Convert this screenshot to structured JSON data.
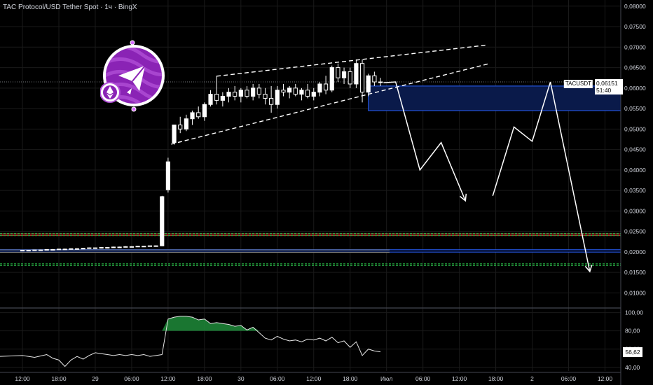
{
  "header": {
    "title": "TAC Protocol/USD Tether Spot · 1ч · BingX"
  },
  "price_label": {
    "symbol": "TACUSDT",
    "price": "0,06151",
    "countdown": "51:40"
  },
  "rsi_label": {
    "value": "56,62"
  },
  "colors": {
    "background": "#000000",
    "candle": "#ffffff",
    "demand_zone": "#0a1a4a",
    "support_blue": "#2962ff",
    "dashed_green": "#26a641",
    "resistance_red": "#c62828",
    "rsi_fill": "#1f8b3a"
  },
  "icons": {
    "logo": "tac-protocol-logo-icon",
    "arrows": "projection-arrow-icon"
  },
  "chart_data": {
    "type": "candlestick",
    "price_axis": {
      "ticks": [
        "0,08000",
        "0,07500",
        "0,07000",
        "0,06500",
        "0,06000",
        "0,05500",
        "0,05000",
        "0,04500",
        "0,04000",
        "0,03500",
        "0,03000",
        "0,02500",
        "0,02000",
        "0,01500",
        "0,01000"
      ],
      "ylim": [
        0.007,
        0.0815
      ]
    },
    "rsi_axis": {
      "ticks": [
        "100,00",
        "80,00",
        "60,00",
        "40,00"
      ],
      "ylim": [
        36,
        102
      ]
    },
    "time_axis": {
      "ticks": [
        {
          "label": "12:00",
          "slot": 0
        },
        {
          "label": "18:00",
          "slot": 6
        },
        {
          "label": "29",
          "slot": 12
        },
        {
          "label": "06:00",
          "slot": 18
        },
        {
          "label": "12:00",
          "slot": 24
        },
        {
          "label": "18:00",
          "slot": 30
        },
        {
          "label": "30",
          "slot": 36
        },
        {
          "label": "06:00",
          "slot": 42
        },
        {
          "label": "12:00",
          "slot": 48
        },
        {
          "label": "18:00",
          "slot": 54
        },
        {
          "label": "Июл",
          "slot": 60
        },
        {
          "label": "06:00",
          "slot": 66
        },
        {
          "label": "12:00",
          "slot": 72
        },
        {
          "label": "18:00",
          "slot": 78
        },
        {
          "label": "2",
          "slot": 84
        },
        {
          "label": "06:00",
          "slot": 90
        },
        {
          "label": "12:00",
          "slot": 96
        }
      ],
      "slot_range": [
        -3.7,
        98.6
      ]
    },
    "candles": [
      [
        0,
        0.0203,
        0.0204,
        0.0202,
        0.0204
      ],
      [
        1,
        0.0204,
        0.0205,
        0.0203,
        0.0204
      ],
      [
        2,
        0.0204,
        0.0205,
        0.0203,
        0.0205
      ],
      [
        3,
        0.0205,
        0.0206,
        0.0204,
        0.0205
      ],
      [
        4,
        0.0205,
        0.0206,
        0.0204,
        0.0206
      ],
      [
        5,
        0.0206,
        0.0207,
        0.0205,
        0.0206
      ],
      [
        6,
        0.0206,
        0.0207,
        0.0205,
        0.0207
      ],
      [
        7,
        0.0207,
        0.0208,
        0.0206,
        0.0207
      ],
      [
        8,
        0.0207,
        0.0208,
        0.0206,
        0.0208
      ],
      [
        9,
        0.0208,
        0.0209,
        0.0207,
        0.0208
      ],
      [
        10,
        0.0208,
        0.021,
        0.0207,
        0.0209
      ],
      [
        11,
        0.0209,
        0.0211,
        0.0208,
        0.021
      ],
      [
        12,
        0.021,
        0.0211,
        0.0209,
        0.021
      ],
      [
        13,
        0.021,
        0.0212,
        0.0209,
        0.0211
      ],
      [
        14,
        0.0211,
        0.0212,
        0.021,
        0.0211
      ],
      [
        15,
        0.0211,
        0.0213,
        0.021,
        0.0212
      ],
      [
        16,
        0.0212,
        0.0213,
        0.0211,
        0.0212
      ],
      [
        17,
        0.0212,
        0.0214,
        0.0211,
        0.0213
      ],
      [
        18,
        0.0213,
        0.0214,
        0.0212,
        0.0213
      ],
      [
        19,
        0.0213,
        0.0214,
        0.0212,
        0.0214
      ],
      [
        20,
        0.0214,
        0.0215,
        0.0213,
        0.0214
      ],
      [
        21,
        0.0214,
        0.0215,
        0.0213,
        0.0215
      ],
      [
        22,
        0.0215,
        0.0216,
        0.0214,
        0.0215
      ],
      [
        23,
        0.0215,
        0.0337,
        0.0214,
        0.0335
      ],
      [
        24,
        0.0352,
        0.043,
        0.0345,
        0.042
      ],
      [
        25,
        0.0467,
        0.051,
        0.0462,
        0.051
      ],
      [
        26,
        0.051,
        0.053,
        0.049,
        0.05
      ],
      [
        27,
        0.05,
        0.0535,
        0.0495,
        0.0525
      ],
      [
        28,
        0.0525,
        0.0545,
        0.051,
        0.054
      ],
      [
        29,
        0.054,
        0.0555,
        0.0525,
        0.053
      ],
      [
        30,
        0.053,
        0.0565,
        0.052,
        0.056
      ],
      [
        31,
        0.056,
        0.0595,
        0.0555,
        0.0585
      ],
      [
        32,
        0.0585,
        0.063,
        0.056,
        0.057
      ],
      [
        33,
        0.057,
        0.059,
        0.0555,
        0.058
      ],
      [
        34,
        0.058,
        0.06,
        0.0565,
        0.059
      ],
      [
        35,
        0.059,
        0.0605,
        0.057,
        0.058
      ],
      [
        36,
        0.058,
        0.06,
        0.0565,
        0.0595
      ],
      [
        37,
        0.0595,
        0.0605,
        0.0575,
        0.058
      ],
      [
        38,
        0.058,
        0.061,
        0.057,
        0.06
      ],
      [
        39,
        0.06,
        0.061,
        0.0575,
        0.0585
      ],
      [
        40,
        0.0585,
        0.06,
        0.056,
        0.0575
      ],
      [
        41,
        0.0575,
        0.0605,
        0.054,
        0.056
      ],
      [
        42,
        0.056,
        0.0605,
        0.055,
        0.0595
      ],
      [
        43,
        0.0595,
        0.061,
        0.058,
        0.059
      ],
      [
        44,
        0.059,
        0.0605,
        0.0575,
        0.06
      ],
      [
        45,
        0.06,
        0.061,
        0.058,
        0.0585
      ],
      [
        46,
        0.0585,
        0.06,
        0.057,
        0.0595
      ],
      [
        47,
        0.0595,
        0.061,
        0.0575,
        0.058
      ],
      [
        48,
        0.058,
        0.06,
        0.057,
        0.059
      ],
      [
        49,
        0.059,
        0.0615,
        0.058,
        0.061
      ],
      [
        50,
        0.061,
        0.063,
        0.0585,
        0.0595
      ],
      [
        51,
        0.0595,
        0.0655,
        0.059,
        0.065
      ],
      [
        52,
        0.065,
        0.066,
        0.0615,
        0.0625
      ],
      [
        53,
        0.0625,
        0.065,
        0.061,
        0.064
      ],
      [
        54,
        0.064,
        0.065,
        0.06,
        0.061
      ],
      [
        55,
        0.061,
        0.067,
        0.06,
        0.066
      ],
      [
        56,
        0.066,
        0.067,
        0.0565,
        0.059
      ],
      [
        57,
        0.059,
        0.0635,
        0.058,
        0.063
      ],
      [
        58,
        0.063,
        0.064,
        0.0605,
        0.0615
      ],
      [
        59,
        0.0615,
        0.0625,
        0.0605,
        0.0615
      ]
    ],
    "rsi": [
      [
        -3.7,
        52
      ],
      [
        0,
        53
      ],
      [
        2,
        51
      ],
      [
        4,
        54
      ],
      [
        5,
        50
      ],
      [
        6,
        48
      ],
      [
        7,
        41
      ],
      [
        8,
        48
      ],
      [
        9,
        52
      ],
      [
        10,
        49
      ],
      [
        11,
        53
      ],
      [
        12,
        56
      ],
      [
        13,
        55
      ],
      [
        14,
        54
      ],
      [
        15,
        53
      ],
      [
        16,
        54
      ],
      [
        17,
        53
      ],
      [
        18,
        54
      ],
      [
        19,
        53
      ],
      [
        20,
        54
      ],
      [
        21,
        52
      ],
      [
        22,
        53
      ],
      [
        23,
        54
      ],
      [
        24,
        93
      ],
      [
        25,
        95
      ],
      [
        26,
        96
      ],
      [
        27,
        96
      ],
      [
        28,
        95
      ],
      [
        29,
        92
      ],
      [
        30,
        93
      ],
      [
        31,
        88
      ],
      [
        32,
        89
      ],
      [
        33,
        88
      ],
      [
        34,
        87
      ],
      [
        35,
        85
      ],
      [
        36,
        86
      ],
      [
        37,
        81
      ],
      [
        38,
        84
      ],
      [
        39,
        78
      ],
      [
        40,
        72
      ],
      [
        41,
        70
      ],
      [
        42,
        74
      ],
      [
        43,
        71
      ],
      [
        44,
        69
      ],
      [
        45,
        70
      ],
      [
        46,
        68
      ],
      [
        47,
        71
      ],
      [
        48,
        70
      ],
      [
        49,
        72
      ],
      [
        50,
        69
      ],
      [
        51,
        73
      ],
      [
        52,
        67
      ],
      [
        53,
        69
      ],
      [
        54,
        62
      ],
      [
        55,
        68
      ],
      [
        56,
        53
      ],
      [
        57,
        60
      ],
      [
        58,
        58
      ],
      [
        59,
        57
      ]
    ],
    "demand_zone": {
      "slot_start": 57,
      "slot_end": 98.6,
      "top": 0.0605,
      "bottom": 0.0545
    },
    "horizontal_levels": [
      {
        "kind": "red",
        "price": 0.0244
      },
      {
        "kind": "red",
        "price": 0.024
      },
      {
        "kind": "green-dashed",
        "price": 0.0245
      },
      {
        "kind": "green-dashed",
        "price": 0.024
      },
      {
        "kind": "blue",
        "price": 0.0205
      },
      {
        "kind": "blue",
        "price": 0.02
      },
      {
        "kind": "green-dashed",
        "price": 0.0171
      },
      {
        "kind": "green-dashed",
        "price": 0.0167
      }
    ],
    "channel": {
      "upper": {
        "from": [
          32,
          0.0629
        ],
        "to": [
          76.5,
          0.0705
        ]
      },
      "lower": {
        "from": [
          24.5,
          0.0463
        ],
        "to": [
          77,
          0.066
        ]
      }
    },
    "projection_a": [
      [
        59.5,
        0.0613
      ],
      [
        61.5,
        0.0615
      ],
      [
        65.5,
        0.04
      ],
      [
        69,
        0.0467
      ],
      [
        73,
        0.0325
      ]
    ],
    "projection_b": [
      [
        77.5,
        0.0337
      ],
      [
        81,
        0.0505
      ],
      [
        84,
        0.047
      ],
      [
        87,
        0.0615
      ],
      [
        93.5,
        0.0152
      ]
    ],
    "current_price": 0.06151
  }
}
